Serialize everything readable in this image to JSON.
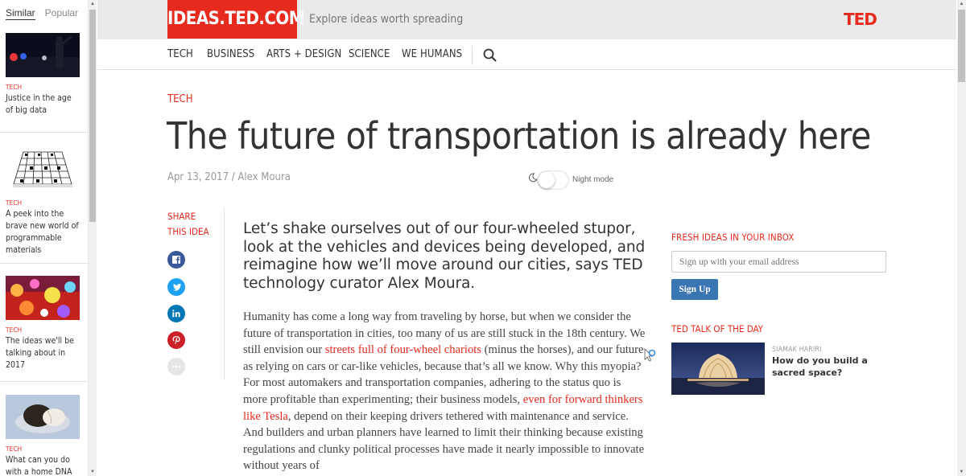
{
  "sidebar": {
    "tabs": [
      "Similar",
      "Popular"
    ],
    "active_tab": "Similar",
    "items": [
      {
        "category": "TECH",
        "title": "Justice in the age of big data"
      },
      {
        "category": "TECH",
        "title": "A peek into the brave new world of programmable materials"
      },
      {
        "category": "TECH",
        "title": "The ideas we'll be talking about in 2017"
      },
      {
        "category": "TECH",
        "title": "What can you do with a home DNA"
      }
    ]
  },
  "header": {
    "logo": "IDEAS.TED.COM",
    "tagline": "Explore ideas worth spreading",
    "brand": "TED"
  },
  "nav": {
    "items": [
      "TECH",
      "BUSINESS",
      "ARTS + DESIGN",
      "SCIENCE",
      "WE HUMANS"
    ]
  },
  "article": {
    "category": "TECH",
    "title": "The future of transportation is already here",
    "byline": "Apr 13, 2017 / Alex Moura",
    "night_mode_label": "Night mode",
    "night_mode_on": false,
    "share_label_line1": "SHARE",
    "share_label_line2": "THIS IDEA",
    "share_buttons": [
      "facebook-icon",
      "twitter-icon",
      "linkedin-icon",
      "pinterest-icon",
      "more-icon"
    ],
    "lede": "Let’s shake ourselves out of our four-wheeled stupor, look at the vehicles and devices being developed, and reimagine how we’ll move around our cities, says TED technology curator Alex Moura.",
    "body": {
      "p1": "Humanity has come a long way from traveling by horse, but when we consider the future of transportation in cities, too many of us are still stuck in the 18th century. We still envision our ",
      "link1": "streets full of four-wheel chariots",
      "p2": " (minus the horses), and our future as relying on cars or car-like vehicles, because that’s all we know. Why this myopia? For most automakers and transportation companies, adhering to the status quo is more profitable than experimenting; their business models, ",
      "link2": "even for forward thinkers like Tesla",
      "p3": ", depend on their keeping drivers tethered with maintenance and service. And builders and urban planners have learned to limit their thinking because existing regulations and clunky political processes have made it nearly impossible to innovate without years of"
    }
  },
  "newsletter": {
    "heading": "FRESH IDEAS IN YOUR INBOX",
    "placeholder": "Sign up with your email address",
    "button": "Sign Up"
  },
  "talk_of_day": {
    "heading": "TED TALK OF THE DAY",
    "speaker": "SIAMAK HARIRI",
    "title": "How do you build a sacred space?"
  },
  "colors": {
    "accent": "#e62b1e",
    "button_blue": "#3a76b4",
    "text": "#333333"
  }
}
